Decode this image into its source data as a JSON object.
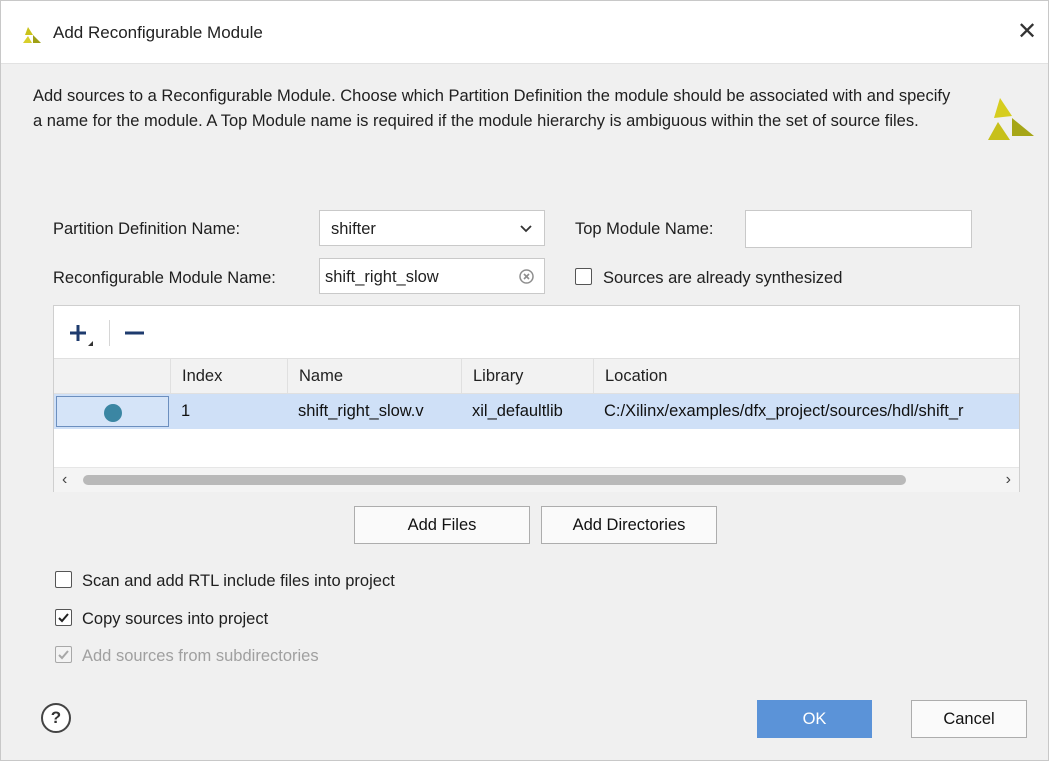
{
  "dialog": {
    "title": "Add Reconfigurable Module",
    "close_glyph": "✕",
    "description": "Add sources to a Reconfigurable Module. Choose which Partition Definition the module should be associated with and specify a name for the module. A Top Module name is required if the module hierarchy is ambiguous within the set of source files."
  },
  "form": {
    "partition_label": "Partition Definition Name:",
    "partition_value": "shifter",
    "top_module_label": "Top Module Name:",
    "top_module_value": "",
    "rm_label": "Reconfigurable Module Name:",
    "rm_value": "shift_right_slow",
    "synthesized_label": "Sources are already synthesized",
    "synthesized_checked": false
  },
  "table": {
    "columns": [
      "",
      "Index",
      "Name",
      "Library",
      "Location"
    ],
    "rows": [
      {
        "index": "1",
        "name": "shift_right_slow.v",
        "library": "xil_defaultlib",
        "location": "C:/Xilinx/examples/dfx_project/sources/hdl/shift_r"
      }
    ],
    "add_tooltip_icon": "plus-icon",
    "remove_tooltip_icon": "minus-icon"
  },
  "buttons": {
    "add_files": "Add Files",
    "add_directories": "Add Directories",
    "ok": "OK",
    "cancel": "Cancel",
    "help": "?"
  },
  "options": {
    "scan_rtl": "Scan and add RTL include files into project",
    "scan_rtl_checked": false,
    "copy_sources": "Copy sources into project",
    "copy_sources_checked": true,
    "add_subdirs": "Add sources from subdirectories",
    "add_subdirs_checked": true,
    "add_subdirs_enabled": false
  },
  "colors": {
    "brand_yellow": "#c9c21a",
    "primary_button": "#5b93d8",
    "row_selected": "#cfe0f7"
  }
}
